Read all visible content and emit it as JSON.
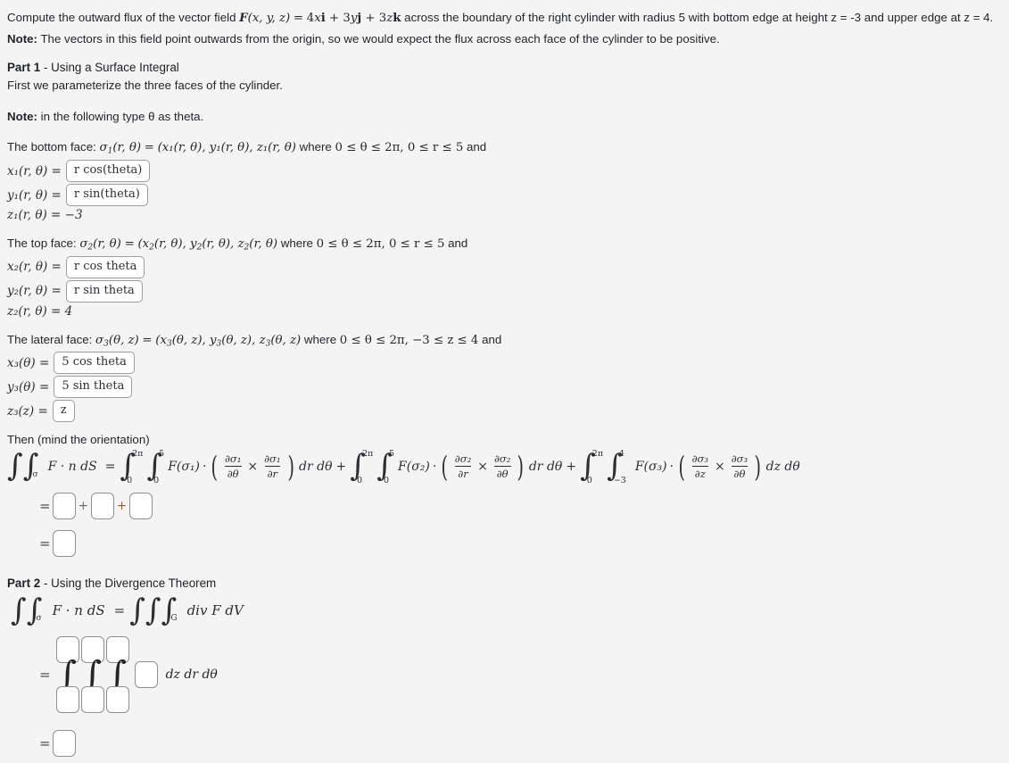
{
  "problem": {
    "statement_pre": "Compute the outward flux of the vector field ",
    "field_label": "F",
    "field_args": "(x, y, z)",
    "field_eq": "=",
    "field_terms": [
      {
        "coef": "4",
        "var": "x",
        "basis": "i"
      },
      {
        "coef": "3",
        "var": "y",
        "basis": "j"
      },
      {
        "coef": "3",
        "var": "z",
        "basis": "k"
      }
    ],
    "statement_post": " across the boundary of the right cylinder with radius 5 with bottom edge at height z = -3 and upper edge at z = 4.",
    "note_label": "Note:",
    "note_text": " The vectors in this field point outwards from the origin, so we would expect the flux across each face of the cylinder to be positive."
  },
  "part1": {
    "heading_bold": "Part 1",
    "heading_rest": " - Using a Surface Integral",
    "intro": "First we parameterize the three faces of the cylinder.",
    "theta_note_label": "Note:",
    "theta_note_text": " in the following type θ as theta.",
    "bottom_face": {
      "lead": "The bottom face: ",
      "sigma": "σ",
      "sigma_sub": "1",
      "args": "(r, θ)",
      "equals": "=",
      "tuple": "(x₁(r, θ), y₁(r, θ), z₁(r, θ)",
      "where": " where ",
      "range_theta": "0 ≤ θ ≤ 2π",
      "range_r": "0 ≤ r ≤ 5",
      "and": " and",
      "x_label": "x₁(r, θ) =",
      "x_value": "r cos(theta)",
      "y_label": "y₁(r, θ) =",
      "y_value": "r sin(theta)",
      "z_label": "z₁(r, θ) = −3"
    },
    "top_face": {
      "lead": "The top face: ",
      "x_label": "x₂(r, θ) =",
      "x_value": "r cos theta",
      "y_label": "y₂(r, θ) =",
      "y_value": "r sin theta",
      "z_label": "z₂(r, θ) = 4",
      "range_theta": "0 ≤ θ ≤ 2π",
      "range_r": "0 ≤ r ≤ 5"
    },
    "lateral_face": {
      "lead": "The lateral face: ",
      "x_label": "x₃(θ) =",
      "x_value": "5 cos theta",
      "y_label": "y₃(θ) =",
      "y_value": "5 sin theta",
      "z_label": "z₃(z) =",
      "z_value": "z",
      "range_theta": "0 ≤ θ ≤ 2π",
      "range_z": "−3 ≤ z ≤ 4"
    },
    "then_label": "Then (mind the orientation)",
    "flux_integral": {
      "lhs": "F · n dS",
      "lhs_sub": "σ",
      "equals": "=",
      "terms": [
        {
          "outer_upper": "2π",
          "outer_lower": "0",
          "inner_upper": "5",
          "inner_lower": "0",
          "integrand": "F(σ₁)",
          "cross_num1": "∂σ₁",
          "cross_den1": "∂θ",
          "cross_num2": "∂σ₁",
          "cross_den2": "∂r",
          "differential": "dr dθ"
        },
        {
          "outer_upper": "2π",
          "outer_lower": "0",
          "inner_upper": "5",
          "inner_lower": "0",
          "integrand": "F(σ₂)",
          "cross_num1": "∂σ₂",
          "cross_den1": "∂r",
          "cross_num2": "∂σ₂",
          "cross_den2": "∂θ",
          "differential": "dr dθ"
        },
        {
          "outer_upper": "2π",
          "outer_lower": "0",
          "inner_upper": "4",
          "inner_lower": "−3",
          "integrand": "F(σ₃)",
          "cross_num1": "∂σ₃",
          "cross_den1": "∂z",
          "cross_num2": "∂σ₃",
          "cross_den2": "∂θ",
          "differential": "dz dθ"
        }
      ],
      "plus": "+",
      "cross_symbol": "×",
      "dot_symbol": "·"
    },
    "sum_row": {
      "equals": "=",
      "plus": "+",
      "box_values": [
        "",
        "",
        ""
      ]
    },
    "total_row": {
      "equals": "=",
      "box_value": ""
    }
  },
  "part2": {
    "heading_bold": "Part 2",
    "heading_rest": " - Using the Divergence Theorem",
    "identity": {
      "lhs": "F · n dS",
      "lhs_sub": "σ",
      "equals": "=",
      "rhs": "div F dV",
      "rhs_sub": "G"
    },
    "triple": {
      "equals": "=",
      "limits": [
        {
          "upper": "",
          "lower": ""
        },
        {
          "upper": "",
          "lower": ""
        },
        {
          "upper": "",
          "lower": ""
        }
      ],
      "integrand_value": "",
      "differential": "dz dr dθ"
    },
    "total_row": {
      "equals": "=",
      "box_value": ""
    }
  },
  "colors": {
    "background": "#f4f4f4",
    "text": "#23262a",
    "box_border": "#8d9196",
    "box_fill": "#ffffff",
    "plus_sign": "#8a5a3c"
  }
}
